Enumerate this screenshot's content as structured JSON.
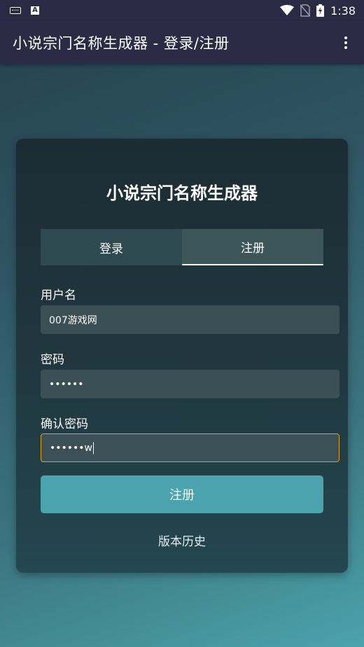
{
  "status_bar": {
    "time": "1:38",
    "icons": [
      "keyboard-icon",
      "a-notification-icon",
      "wifi-icon",
      "no-sim-icon",
      "battery-charging-icon"
    ]
  },
  "app_bar": {
    "title": "小说宗门名称生成器 - 登录/注册",
    "menu_icon": "more-vert-icon"
  },
  "card": {
    "title": "小说宗门名称生成器",
    "tabs": [
      {
        "label": "登录",
        "active": false
      },
      {
        "label": "注册",
        "active": true
      }
    ],
    "username": {
      "label": "用户名",
      "value": "007游戏网"
    },
    "password": {
      "label": "密码",
      "value": "••••••"
    },
    "confirm_password": {
      "label": "确认密码",
      "value": "••••••w"
    },
    "submit_label": "注册",
    "history_link": "版本历史"
  },
  "colors": {
    "status_bar": "#2a2a44",
    "app_bar": "#2b2b45",
    "button": "#4ba3ae",
    "focus_border": "#e6a100"
  }
}
